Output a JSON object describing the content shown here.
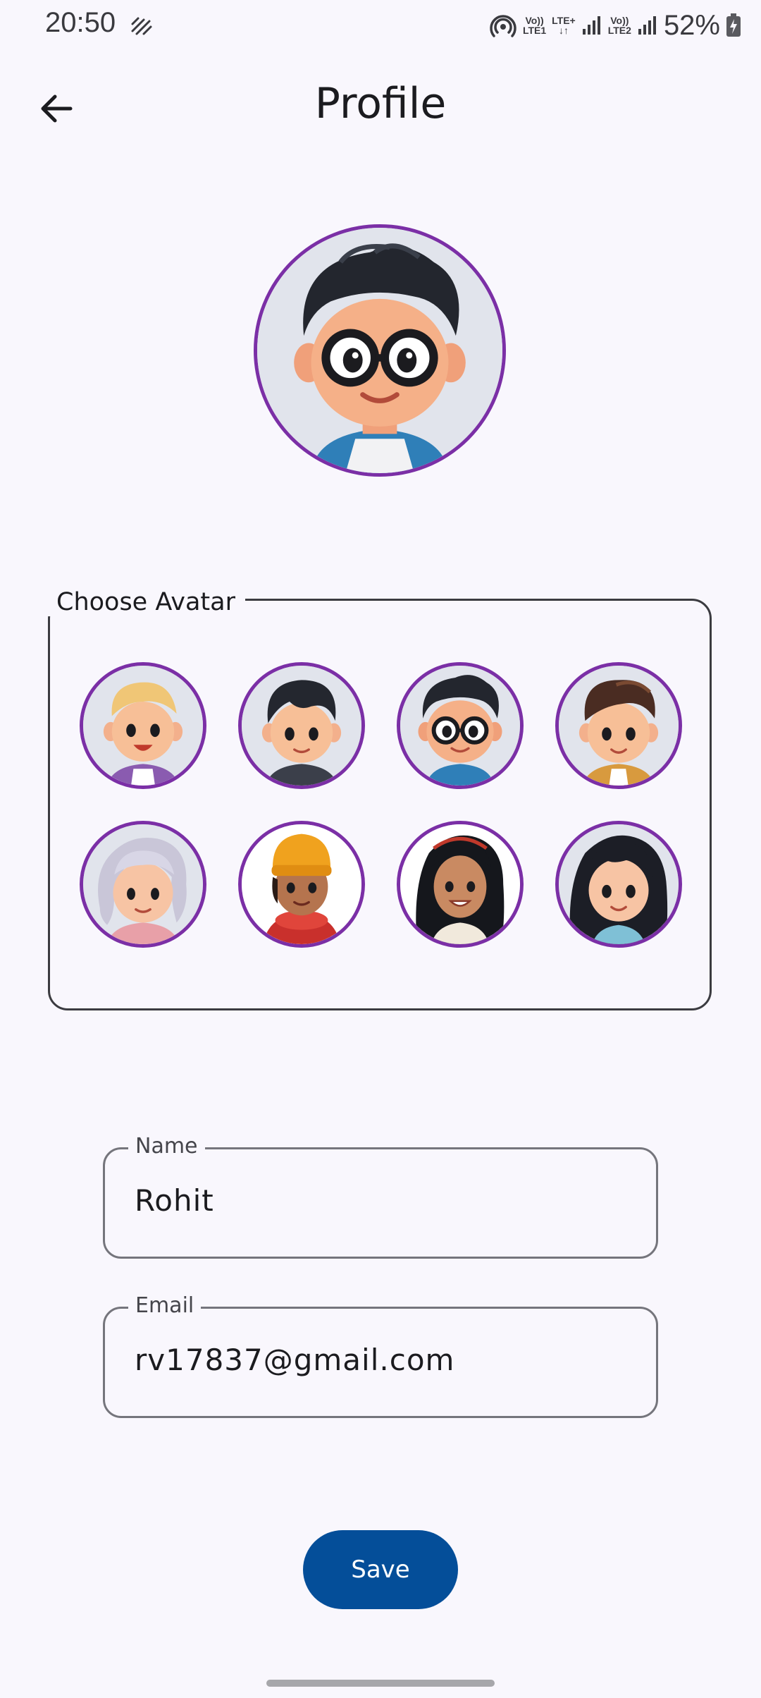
{
  "status_bar": {
    "time": "20:50",
    "sim1_line1": "Vo))",
    "sim1_line2": "LTE1",
    "data_line1": "LTE+",
    "data_line2": "↓↑",
    "sim2_line1": "Vo))",
    "sim2_line2": "LTE2",
    "battery": "52%"
  },
  "header": {
    "title": "Profile"
  },
  "avatar_picker": {
    "label": "Choose Avatar",
    "options": [
      "boy-blonde",
      "boy-black-swept",
      "boy-glasses",
      "boy-brown",
      "grandma",
      "girl-beanie",
      "woman-long-hair",
      "girl-black-hair"
    ],
    "selected": "boy-glasses"
  },
  "form": {
    "name_label": "Name",
    "name_value": "Rohit",
    "email_label": "Email",
    "email_value": "rv17837@gmail.com"
  },
  "actions": {
    "save_label": "Save"
  },
  "colors": {
    "accent": "#044e99",
    "avatar_ring": "#7b2fa6",
    "background": "#f9f7fd"
  }
}
